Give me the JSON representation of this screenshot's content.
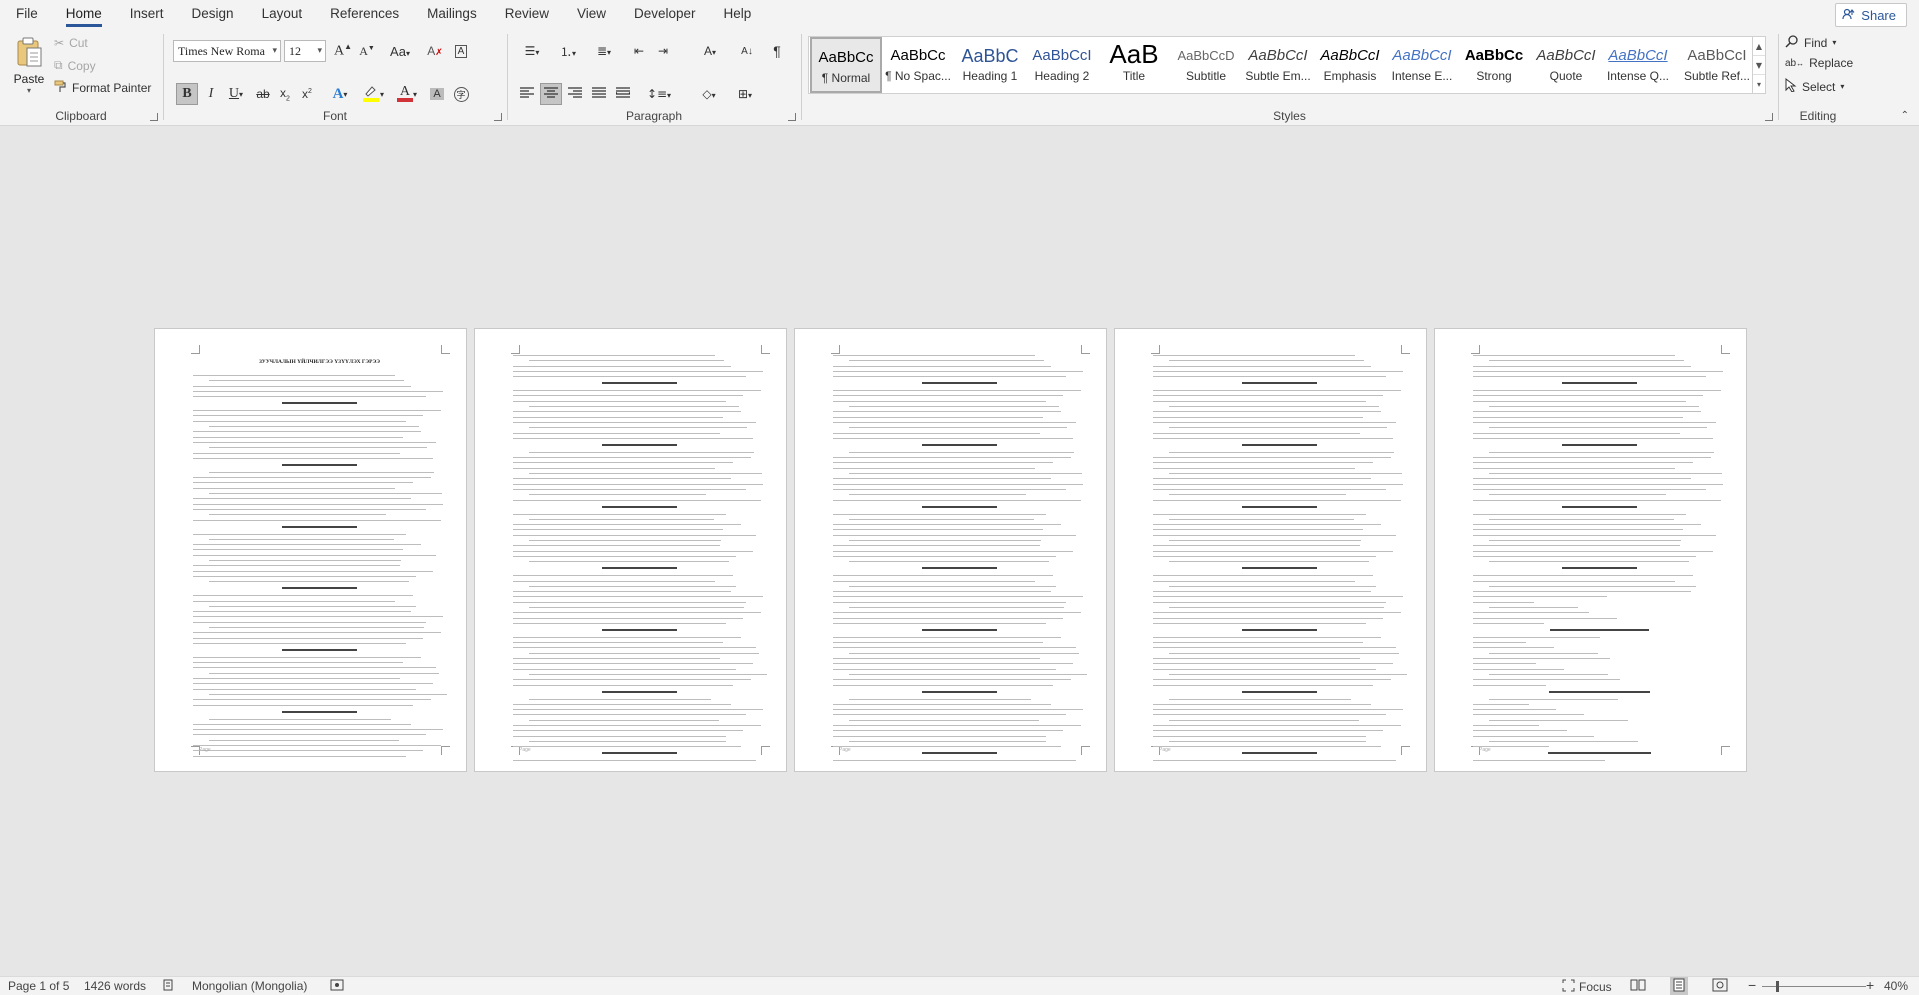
{
  "tabs": [
    "File",
    "Home",
    "Insert",
    "Design",
    "Layout",
    "References",
    "Mailings",
    "Review",
    "View",
    "Developer",
    "Help"
  ],
  "active_tab": "Home",
  "share_label": "Share",
  "clipboard": {
    "group_label": "Clipboard",
    "paste": "Paste",
    "cut": "Cut",
    "copy": "Copy",
    "format_painter": "Format Painter"
  },
  "font": {
    "group_label": "Font",
    "font_name": "Times New Roma",
    "font_size": "12"
  },
  "paragraph": {
    "group_label": "Paragraph"
  },
  "styles": {
    "group_label": "Styles",
    "items": [
      {
        "preview": "AaBbCc",
        "name": "¶ Normal"
      },
      {
        "preview": "AaBbCc",
        "name": "¶ No Spac..."
      },
      {
        "preview": "AaBbC",
        "name": "Heading 1"
      },
      {
        "preview": "AaBbCcI",
        "name": "Heading 2"
      },
      {
        "preview": "AaB",
        "name": "Title"
      },
      {
        "preview": "AaBbCcD",
        "name": "Subtitle"
      },
      {
        "preview": "AaBbCcI",
        "name": "Subtle Em..."
      },
      {
        "preview": "AaBbCcI",
        "name": "Emphasis"
      },
      {
        "preview": "AaBbCcI",
        "name": "Intense E..."
      },
      {
        "preview": "AaBbCc",
        "name": "Strong"
      },
      {
        "preview": "AaBbCcI",
        "name": "Quote"
      },
      {
        "preview": "AaBbCcI",
        "name": "Intense Q..."
      },
      {
        "preview": "AaBbCcI",
        "name": "Subtle Ref..."
      }
    ]
  },
  "editing": {
    "group_label": "Editing",
    "find": "Find",
    "replace": "Replace",
    "select": "Select"
  },
  "document": {
    "page1_title": "ЗУУЧЛАЛЫН ҮЙЛЧИЛГЭЭ ҮЗҮҮЛЭХ ГЭРЭЭ",
    "page_footer": "Page"
  },
  "status": {
    "page": "Page 1 of 5",
    "words": "1426 words",
    "language": "Mongolian (Mongolia)",
    "focus": "Focus",
    "zoom": "40%"
  },
  "colors": {
    "accent": "#2b579a",
    "font_color": "#d13438",
    "highlight": "#ffff00"
  }
}
